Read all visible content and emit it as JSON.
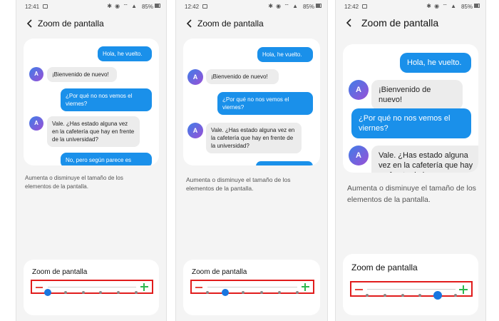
{
  "screens": [
    {
      "status": {
        "time": "12:41",
        "icons": "✱ ◉ ⌔ ▲",
        "battery": "85%"
      },
      "title": "Zoom de pantalla",
      "messages": {
        "sent1": "Hola, he vuelto.",
        "recv1": "¡Bienvenido de nuevo!",
        "sent2": "¿Por qué no nos vemos el viernes?",
        "recv2": "Vale. ¿Has estado alguna vez en la cafetería que hay en frente de la universidad?",
        "sent3": "No, pero según parece es",
        "avatar": "A"
      },
      "description": "Aumenta o disminuye el tamaño de los elementos de la pantalla.",
      "zoom_label": "Zoom de pantalla",
      "zoom_level": 0,
      "zoom_steps": 6
    },
    {
      "status": {
        "time": "12:42",
        "icons": "✱ ◉ ⌔ ▲",
        "battery": "85%"
      },
      "title": "Zoom de pantalla",
      "messages": {
        "sent1": "Hola, he vuelto.",
        "recv1": "¡Bienvenido de nuevo!",
        "sent2": "¿Por qué no nos vemos el viernes?",
        "recv2": "Vale. ¿Has estado alguna vez en la cafetería que hay en frente de la universidad?",
        "avatar": "A"
      },
      "description": "Aumenta o disminuye el tamaño de los elementos de la pantalla.",
      "zoom_label": "Zoom de pantalla",
      "zoom_level": 1,
      "zoom_steps": 6
    },
    {
      "status": {
        "time": "12:42",
        "icons": "✱ ◉ ⌔ ▲",
        "battery": "85%"
      },
      "title": "Zoom de pantalla",
      "messages": {
        "sent1": "Hola, he vuelto.",
        "recv1": "¡Bienvenido de nuevo!",
        "sent2": "¿Por qué no nos vemos el viernes?",
        "recv2": "Vale. ¿Has estado alguna vez en la cafetería que hay en frente de la",
        "avatar": "A"
      },
      "description": "Aumenta o disminuye el tamaño de los elementos de la pantalla.",
      "zoom_label": "Zoom de pantalla",
      "zoom_level": 4,
      "zoom_steps": 6
    }
  ],
  "colors": {
    "sent_bubble": "#1a90ea",
    "received_bubble": "#ececec",
    "slider_thumb": "#1976e0",
    "minus": "#e5453d",
    "plus": "#2db84f",
    "highlight_box": "#e11c1c"
  }
}
